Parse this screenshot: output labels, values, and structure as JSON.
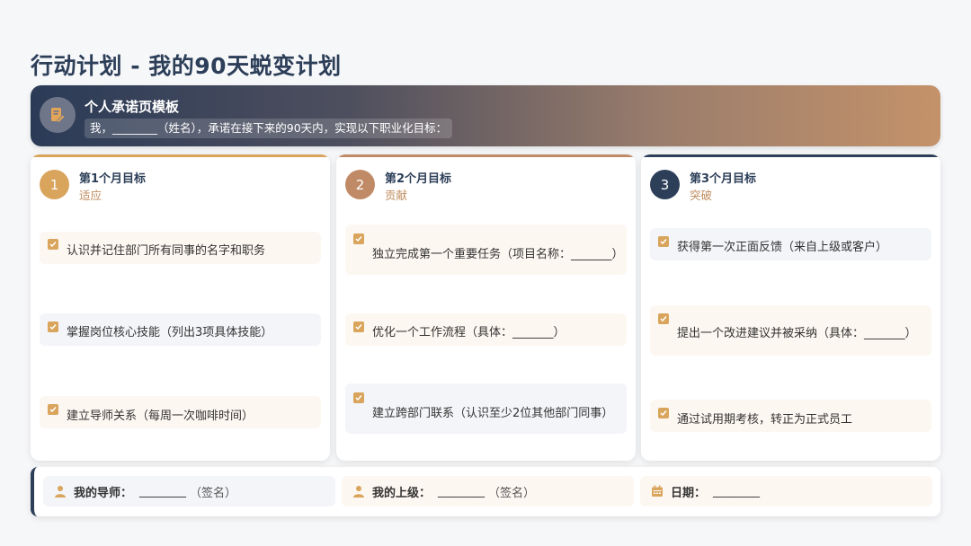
{
  "title": "行动计划 - 我的90天蜕变计划",
  "banner": {
    "icon": "edit-document-icon",
    "title": "个人承诺页模板",
    "text": "我，________（姓名），承诺在接下来的90天内，实现以下职业化目标："
  },
  "colors": {
    "accent_gold": "#d9a45c",
    "accent_brown": "#c08a67",
    "navy": "#2c3e58"
  },
  "months": [
    {
      "number": "1",
      "title": "第1个月目标",
      "subtitle": "适应",
      "items": [
        "认识并记住部门所有同事的名字和职务",
        "掌握岗位核心技能（列出3项具体技能）",
        "建立导师关系（每周一次咖啡时间）"
      ]
    },
    {
      "number": "2",
      "title": "第2个月目标",
      "subtitle": "贡献",
      "items": [
        "独立完成第一个重要任务（项目名称：_______）",
        "优化一个工作流程（具体：_______）",
        "建立跨部门联系（认识至少2位其他部门同事）"
      ]
    },
    {
      "number": "3",
      "title": "第3个月目标",
      "subtitle": "突破",
      "items": [
        "获得第一次正面反馈（来自上级或客户）",
        "提出一个改进建议并被采纳（具体：_______）",
        "通过试用期考核，转正为正式员工"
      ]
    }
  ],
  "signatures": {
    "mentor": {
      "icon": "person-icon",
      "label": "我的导师：",
      "blank": "________",
      "note": "（签名）"
    },
    "supervisor": {
      "icon": "person-icon",
      "label": "我的上级：",
      "blank": "________",
      "note": "（签名）"
    },
    "date": {
      "icon": "calendar-icon",
      "label": "日期：",
      "blank": "________"
    }
  }
}
